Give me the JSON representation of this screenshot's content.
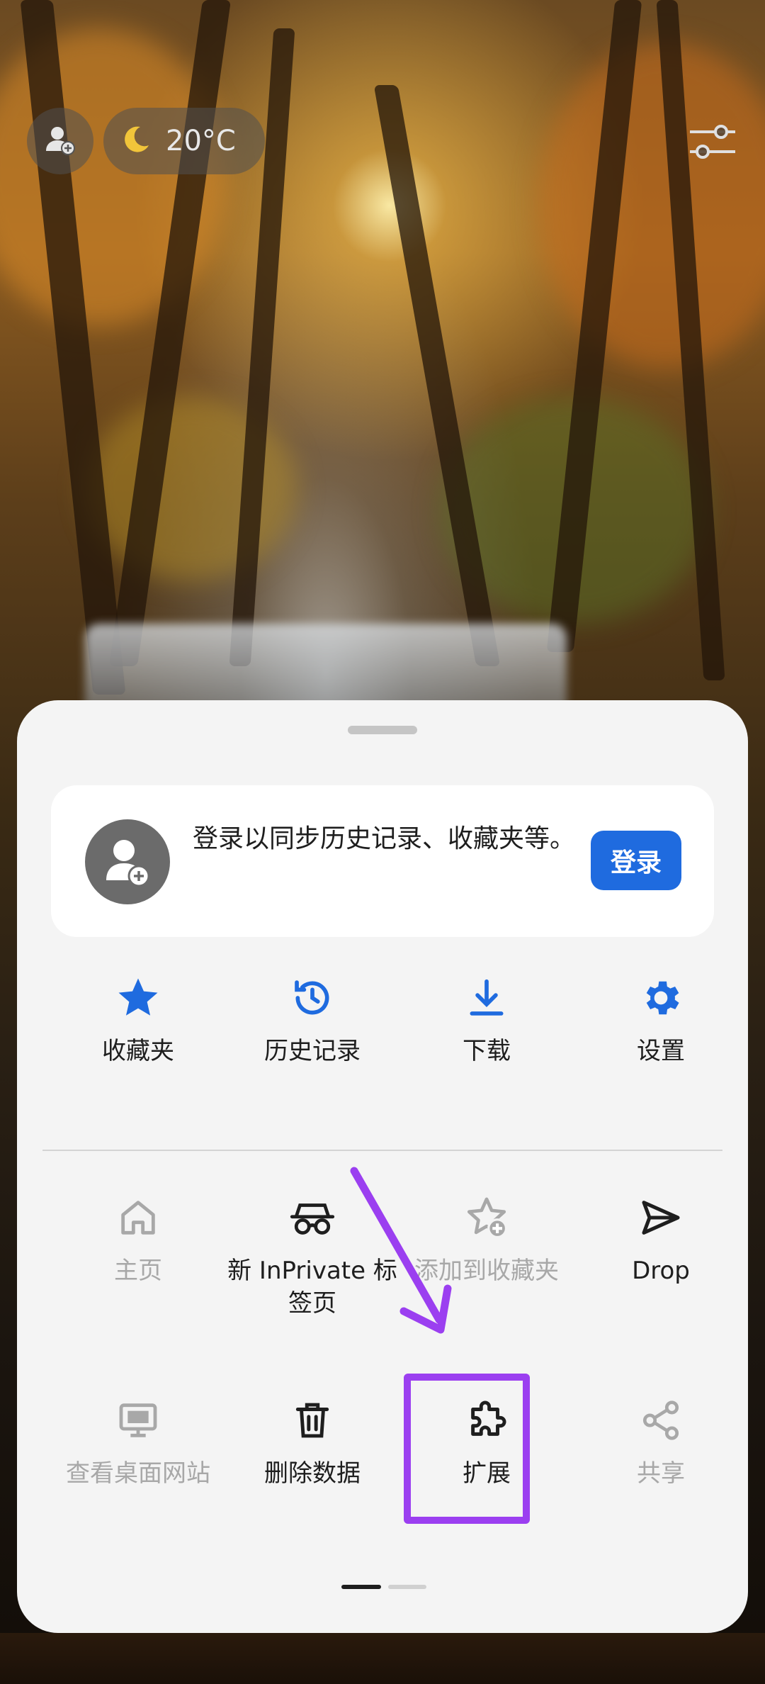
{
  "topbar": {
    "profile_icon": "add-profile-icon",
    "weather": {
      "icon": "moon-icon",
      "temperature": "20°C"
    },
    "customize_icon": "sliders-icon"
  },
  "sheet": {
    "signin": {
      "message": "登录以同步历史记录、收藏夹等。",
      "button_label": "登录"
    },
    "primary_actions": [
      {
        "label": "收藏夹",
        "icon": "star-icon",
        "color": "#1f6bdf"
      },
      {
        "label": "历史记录",
        "icon": "history-icon",
        "color": "#1f6bdf"
      },
      {
        "label": "下载",
        "icon": "download-icon",
        "color": "#1f6bdf"
      },
      {
        "label": "设置",
        "icon": "gear-icon",
        "color": "#1f6bdf"
      }
    ],
    "secondary_actions": [
      {
        "label": "主页",
        "icon": "home-icon",
        "enabled": false
      },
      {
        "label": "新 InPrivate 标签页",
        "icon": "inprivate-icon",
        "enabled": true
      },
      {
        "label": "添加到收藏夹",
        "icon": "add-favorite-icon",
        "enabled": false
      },
      {
        "label": "Drop",
        "icon": "send-icon",
        "enabled": true
      },
      {
        "label": "查看桌面网站",
        "icon": "desktop-icon",
        "enabled": false
      },
      {
        "label": "删除数据",
        "icon": "trash-icon",
        "enabled": true
      },
      {
        "label": "扩展",
        "icon": "puzzle-icon",
        "enabled": true
      },
      {
        "label": "共享",
        "icon": "share-icon",
        "enabled": false
      }
    ],
    "page_indicator": {
      "current": 1,
      "total": 2
    }
  },
  "annotation": {
    "color": "#9b3ff0"
  }
}
